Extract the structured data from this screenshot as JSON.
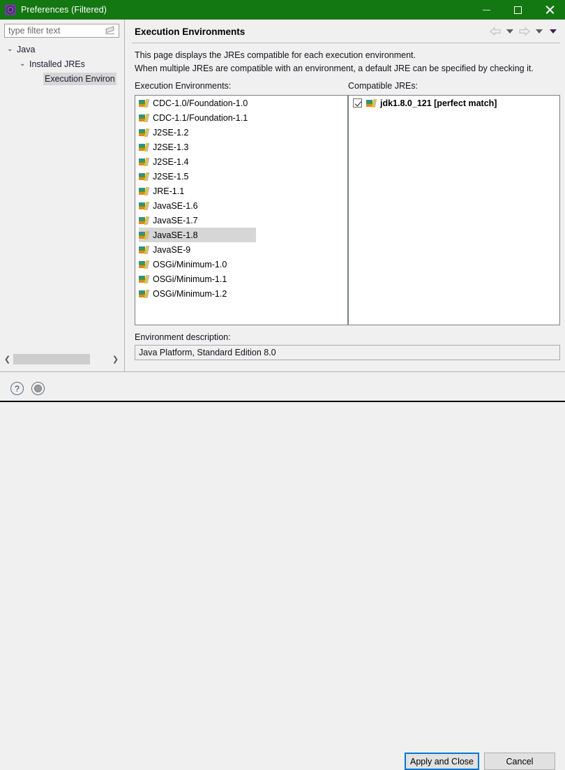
{
  "window": {
    "title": "Preferences (Filtered)",
    "icon": "preferences-gear-icon",
    "titlebar_color": "#137712",
    "buttons": {
      "minimize": "minimize-button",
      "maximize": "maximize-button",
      "close": "close-button"
    }
  },
  "filter": {
    "placeholder": "type filter text",
    "value": "",
    "clear_icon": "eraser-clear-icon"
  },
  "tree": {
    "items": [
      {
        "label": "Java",
        "indent": 1,
        "twisty": "⌄",
        "expanded": true,
        "selected": false
      },
      {
        "label": "Installed JREs",
        "indent": 2,
        "twisty": "⌄",
        "expanded": true,
        "selected": false
      },
      {
        "label": "Execution Environ",
        "indent": 3,
        "twisty": "",
        "expanded": false,
        "selected": true
      }
    ]
  },
  "page": {
    "title": "Execution Environments",
    "description_line1": "This page displays the JREs compatible for each execution environment.",
    "description_line2": "When multiple JREs are compatible with an environment, a default JRE can be specified by checking it."
  },
  "nav": {
    "back": "back-arrow-icon",
    "back_menu": "back-dropdown-icon",
    "forward": "forward-arrow-icon",
    "forward_menu": "forward-dropdown-icon",
    "view_menu": "view-menu-dropdown-icon"
  },
  "execution_environments": {
    "label": "Execution Environments:",
    "items": [
      {
        "name": "CDC-1.0/Foundation-1.0",
        "selected": false
      },
      {
        "name": "CDC-1.1/Foundation-1.1",
        "selected": false
      },
      {
        "name": "J2SE-1.2",
        "selected": false
      },
      {
        "name": "J2SE-1.3",
        "selected": false
      },
      {
        "name": "J2SE-1.4",
        "selected": false
      },
      {
        "name": "J2SE-1.5",
        "selected": false
      },
      {
        "name": "JRE-1.1",
        "selected": false
      },
      {
        "name": "JavaSE-1.6",
        "selected": false
      },
      {
        "name": "JavaSE-1.7",
        "selected": false
      },
      {
        "name": "JavaSE-1.8",
        "selected": true
      },
      {
        "name": "JavaSE-9",
        "selected": false
      },
      {
        "name": "OSGi/Minimum-1.0",
        "selected": false
      },
      {
        "name": "OSGi/Minimum-1.1",
        "selected": false
      },
      {
        "name": "OSGi/Minimum-1.2",
        "selected": false
      }
    ]
  },
  "compatible_jres": {
    "label": "Compatible JREs:",
    "items": [
      {
        "name": "jdk1.8.0_121 [perfect match]",
        "checked": true
      }
    ]
  },
  "environment_description": {
    "label": "Environment description:",
    "value": "Java Platform, Standard Edition 8.0"
  },
  "scrollbar": {
    "left_arrow": "❮",
    "right_arrow": "❯"
  },
  "footer": {
    "help_icon": "?",
    "restore_icon": "restore-defaults-icon",
    "apply_label": "Apply and Close",
    "cancel_label": "Cancel",
    "default_button_color": "#0078d7"
  }
}
